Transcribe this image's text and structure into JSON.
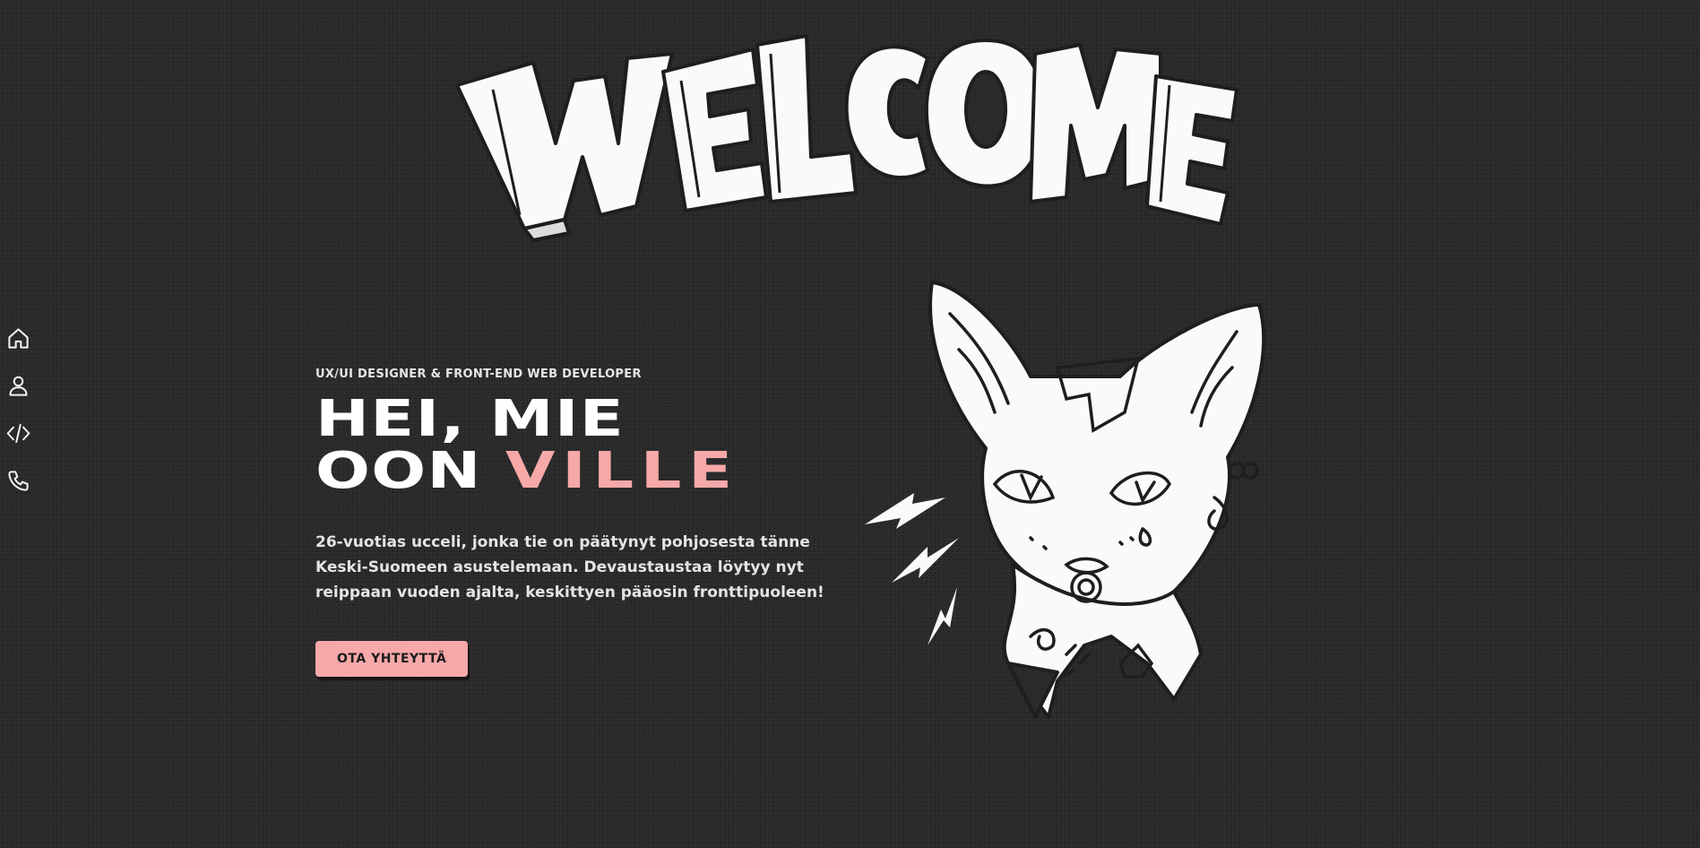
{
  "nav": {
    "items": [
      {
        "icon": "home-icon",
        "label": "Home"
      },
      {
        "icon": "user-icon",
        "label": "About"
      },
      {
        "icon": "code-icon",
        "label": "Projects"
      },
      {
        "icon": "phone-icon",
        "label": "Contact"
      }
    ]
  },
  "hero": {
    "eyebrow": "UX/UI DESIGNER & FRONT-END WEB DEVELOPER",
    "headline_line1": "HEI, MIE",
    "headline_line2_prefix": "OON ",
    "headline_name": "VILLE",
    "intro": "26-vuotias ucceli, jonka tie on päätynyt pohjosesta tänne Keski-Suomeen asustelemaan. Devaustaustaa löytyy nyt reippaan vuoden ajalta, keskittyen pääosin fronttipuoleen!",
    "cta_label": "OTA YHTEYTTÄ"
  },
  "art": {
    "welcome_text": "WELCOME"
  },
  "colors": {
    "background": "#292929",
    "accent": "#f7a8a8",
    "text": "#ececec"
  }
}
